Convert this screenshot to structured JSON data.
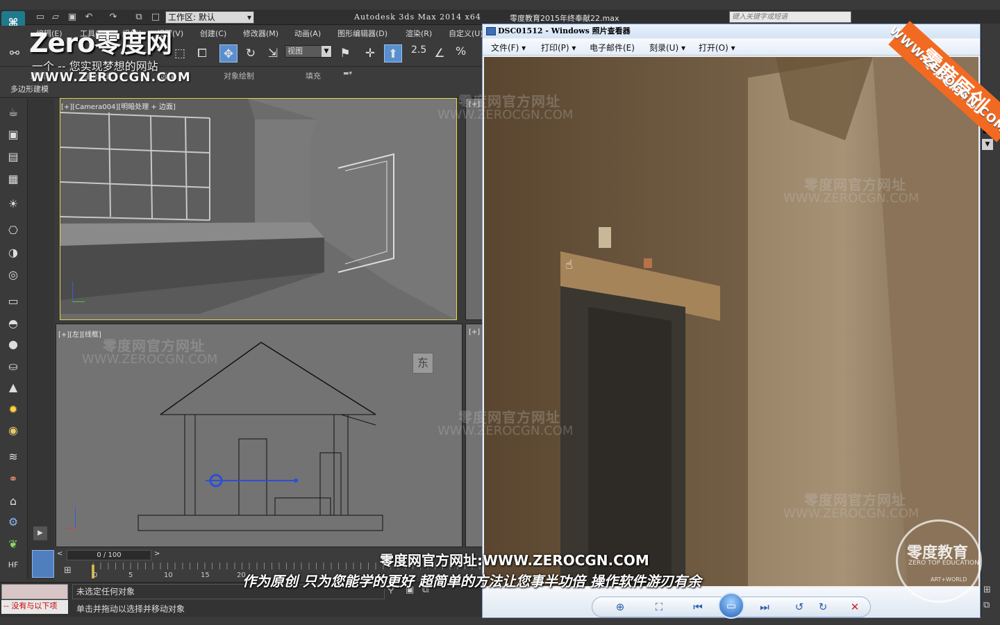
{
  "app": {
    "title": "Autodesk 3ds Max  2014 x64",
    "document": "零度教育2015年终奉献22.max",
    "workspace_label": "工作区: 默认",
    "search_placeholder": "键入关键字或短语"
  },
  "menu": [
    "编辑(E)",
    "工具(T)",
    "组(G)",
    "视图(V)",
    "创建(C)",
    "修改器(M)",
    "动画(A)",
    "图形编辑器(D)",
    "渲染(R)",
    "自定义(U)"
  ],
  "toolbar": {
    "view_select": "视图",
    "snap_label": "2.5",
    "percent_label": "%"
  },
  "ribbon": {
    "tabs": [
      "建模",
      "自由形式",
      "选择",
      "对象绘制",
      "填充"
    ],
    "sub_label": "多边形建模"
  },
  "viewports": {
    "camera": "[+][Camera004][明暗处理 + 边面]",
    "right_top": "[+]",
    "left": "[+][左][线框]",
    "right_bot": "[+]",
    "left_cube": "东"
  },
  "timeline": {
    "slider_text": "0 / 100",
    "ticks": [
      "0",
      "5",
      "10",
      "15",
      "20"
    ]
  },
  "status": {
    "selection": "未选定任何对象",
    "prompt": "单击并拖动以选择并移动对象",
    "left_label": "-- 没有与以下项"
  },
  "viewer": {
    "title": "DSC01512 - Windows 照片查看器",
    "menu": [
      "文件(F)",
      "打印(P)",
      "电子邮件(E)",
      "刻录(U)",
      "打开(O)"
    ]
  },
  "overlay": {
    "logo_brand": "Zero零度网",
    "logo_slogan": "一个 -- 您实现梦想的网站",
    "logo_url": "WWW.ZEROCGN.COM",
    "watermark_cn": "零度网官方网址",
    "watermark_url": "WWW.ZEROCGN.COM",
    "subtitle_1": "零度网官方网址:WWW.ZEROCGN.COM",
    "subtitle_2": "作为原创 只为您能学的更好 超简单的方法让您事半功倍 操作软件游刃有余",
    "corner_ribbon": "零度原创",
    "corner_url": "WWW.ZEROCGN.COM",
    "seal_title": "零度教育",
    "seal_sub": "ZERO TOP EDUCATION",
    "seal_sub2": "ART+WORLD"
  },
  "colors": {
    "accent_orange": "#f26a22",
    "viewport_active_border": "#e8d44d",
    "viewer_blue": "#2b5ca8"
  }
}
